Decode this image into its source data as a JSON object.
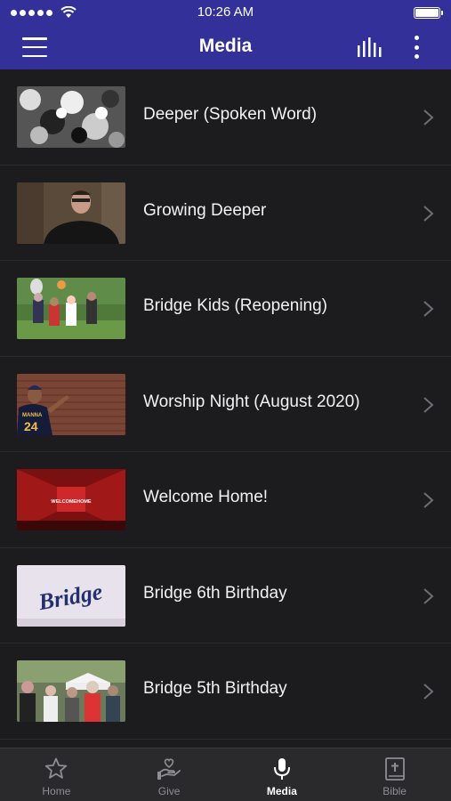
{
  "status_bar": {
    "time": "10:26 AM"
  },
  "header": {
    "title": "Media"
  },
  "media_items": [
    {
      "title": "Deeper (Spoken Word)",
      "thumbnail": "abstract-art"
    },
    {
      "title": "Growing Deeper",
      "thumbnail": "speaker-portrait"
    },
    {
      "title": "Bridge Kids (Reopening)",
      "thumbnail": "kids-outdoor"
    },
    {
      "title": "Worship Night (August 2020)",
      "thumbnail": "worship-brick-wall"
    },
    {
      "title": "Welcome Home!",
      "thumbnail": "welcome-home-stage"
    },
    {
      "title": "Bridge 6th Birthday",
      "thumbnail": "bridge-script-logo"
    },
    {
      "title": "Bridge 5th Birthday",
      "thumbnail": "outdoor-crowd"
    }
  ],
  "thumb_text": {
    "jersey_name": "MANNA",
    "jersey_number": "24",
    "welcome": "WELCOMEHOME",
    "bridge_logo": "Bridge"
  },
  "tab_bar": {
    "tabs": [
      {
        "label": "Home",
        "icon": "star-icon",
        "active": false
      },
      {
        "label": "Give",
        "icon": "give-hand-heart-icon",
        "active": false
      },
      {
        "label": "Media",
        "icon": "microphone-icon",
        "active": true
      },
      {
        "label": "Bible",
        "icon": "bible-icon",
        "active": false
      }
    ]
  },
  "colors": {
    "header_bg": "#33309a",
    "list_bg": "#1c1c1e",
    "tab_bg": "#2a2a2c"
  }
}
